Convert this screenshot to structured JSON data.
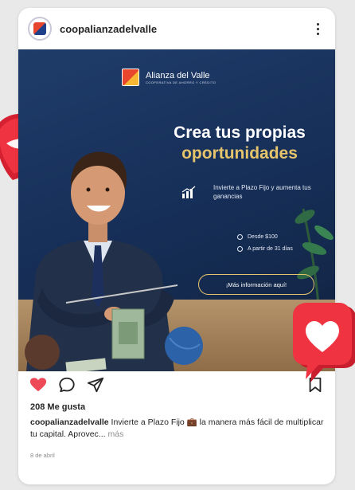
{
  "post": {
    "username": "coopalianzadelvalle",
    "likes": "208 Me gusta",
    "caption_user": "coopalianzadelvalle",
    "caption_text": "Invierte a Plazo Fijo 💼 la manera más fácil de multiplicar tu capital. Aprovec...",
    "caption_more": "más",
    "date": "8 de abril"
  },
  "ad": {
    "brand_name": "Alianza del Valle",
    "brand_sub": "COOPERATIVA DE AHORRO Y CRÉDITO",
    "headline_line1": "Crea tus propias",
    "headline_line2": "oportunidades",
    "invest_text": "Invierte a Plazo Fijo y aumenta tus ganancias",
    "features": [
      "Desde $100",
      "A partir de 31 días"
    ],
    "cta": "¡Más información aquí!"
  },
  "icons": {
    "like": "heart-icon",
    "comment": "comment-icon",
    "share": "share-icon",
    "save": "bookmark-icon",
    "more": "more-icon"
  },
  "colors": {
    "heart": "#ed4956",
    "gold": "#e6c46b",
    "navy": "#17305a"
  }
}
